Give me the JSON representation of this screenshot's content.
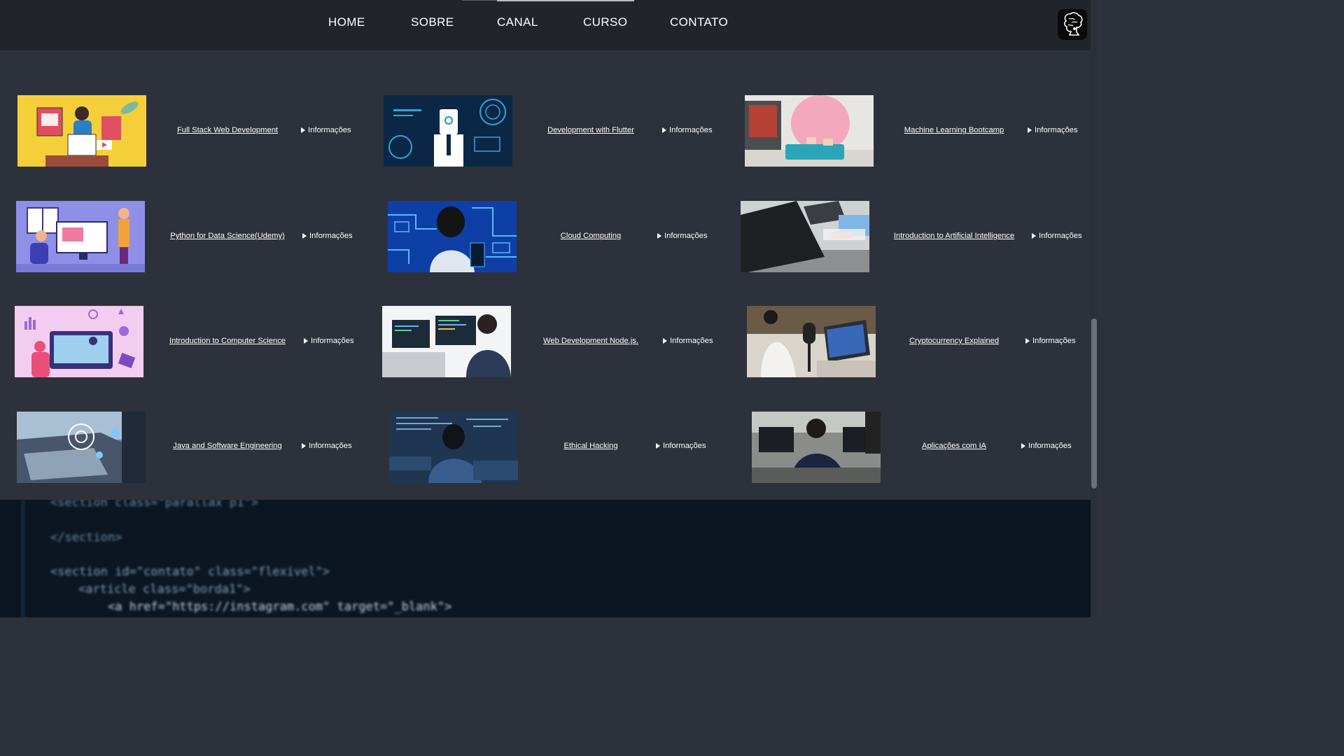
{
  "nav": {
    "items": [
      "HOME",
      "SOBRE",
      "CANAL",
      "CURSO",
      "CONTATO"
    ]
  },
  "courses": [
    {
      "title": "Full Stack Web Development",
      "info": "Informações"
    },
    {
      "title": "Development with Flutter",
      "info": "Informações"
    },
    {
      "title": "Machine Learning Bootcamp",
      "info": "Informações"
    },
    {
      "title": "Python for Data Science(Udemy)",
      "info": "Informações"
    },
    {
      "title": "Cloud Computing",
      "info": "Informações"
    },
    {
      "title": "Introduction to Artificial Intelligence",
      "info": "Informações"
    },
    {
      "title": "Introduction to Computer Science",
      "info": "Informações"
    },
    {
      "title": "Web Development Node.js.",
      "info": "Informações"
    },
    {
      "title": "Cryptocurrency Explained",
      "info": "Informações"
    },
    {
      "title": "Java and Software Engineering",
      "info": "Informações"
    },
    {
      "title": "Ethical Hacking",
      "info": "Informações"
    },
    {
      "title": "Aplicações com IA",
      "info": "Informações"
    }
  ],
  "footer_code": {
    "lines": [
      "<section class=\"parallax p1\">",
      "</section>",
      "<section id=\"contato\" class=\"flexivel\">",
      "<article class=\"borda1\">",
      "<a href=\"https://instagram.com\" target=\"_blank\">"
    ]
  },
  "icons": {
    "logo": "brain-logo-icon",
    "info_marker": "triangle-right-icon"
  },
  "colors": {
    "background": "#2d313b",
    "navbar": "#21252b",
    "code_background": "#0b1622"
  }
}
